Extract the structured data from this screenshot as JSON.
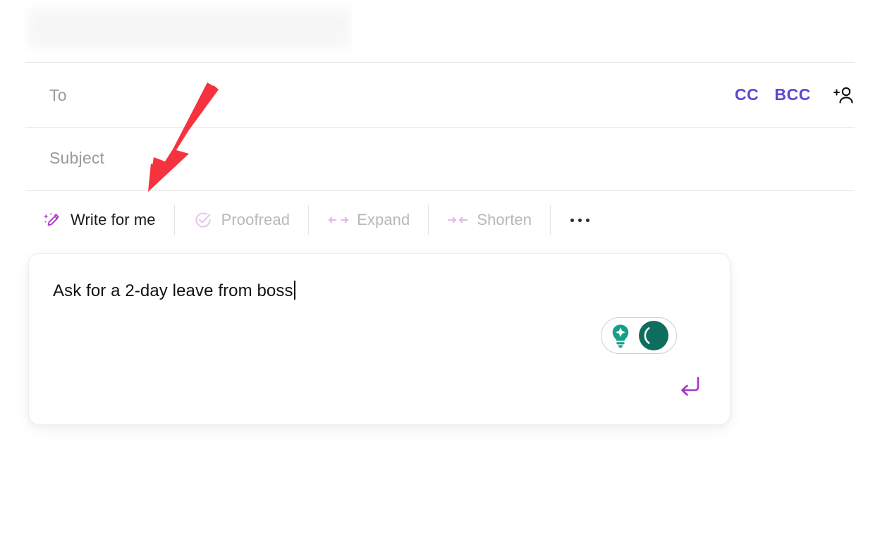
{
  "app": {
    "type": "email-compose",
    "header_placeholder": ""
  },
  "compose": {
    "to": {
      "placeholder": "To",
      "value": ""
    },
    "subject": {
      "placeholder": "Subject",
      "value": ""
    },
    "cc_label": "CC",
    "bcc_label": "BCC",
    "add_recipient_icon": "add-person-icon"
  },
  "ai_toolbar": {
    "items": [
      {
        "label": "Write for me",
        "icon": "magic-pencil-icon",
        "state": "active"
      },
      {
        "label": "Proofread",
        "icon": "check-circle-icon",
        "state": "disabled"
      },
      {
        "label": "Expand",
        "icon": "expand-arrows-icon",
        "state": "disabled"
      },
      {
        "label": "Shorten",
        "icon": "shrink-arrows-icon",
        "state": "disabled"
      }
    ],
    "more_icon": "more-horizontal-icon"
  },
  "prompt": {
    "text": "Ask for a 2-day leave from boss",
    "caret_visible": true,
    "toggle": {
      "name": "ai-mode-toggle",
      "state": "on",
      "left_icon": "lightbulb-sparkle-icon",
      "right_icon": "crescent-circle-icon"
    },
    "submit_icon": "enter-return-icon"
  },
  "annotation": {
    "type": "arrow",
    "color": "#f5333f",
    "points_to": "Write for me"
  },
  "colors": {
    "accent_purple": "#5b46d6",
    "magic_magenta": "#b63bd4",
    "muted_pink": "#e6c3ec",
    "teal_bulb": "#14a188",
    "teal_dark": "#0e6d5e",
    "text_primary": "#121212",
    "text_muted": "#b8b8b8",
    "placeholder": "#9a9a9a",
    "divider": "#e8e8e8",
    "annotation_red": "#f5333f"
  }
}
